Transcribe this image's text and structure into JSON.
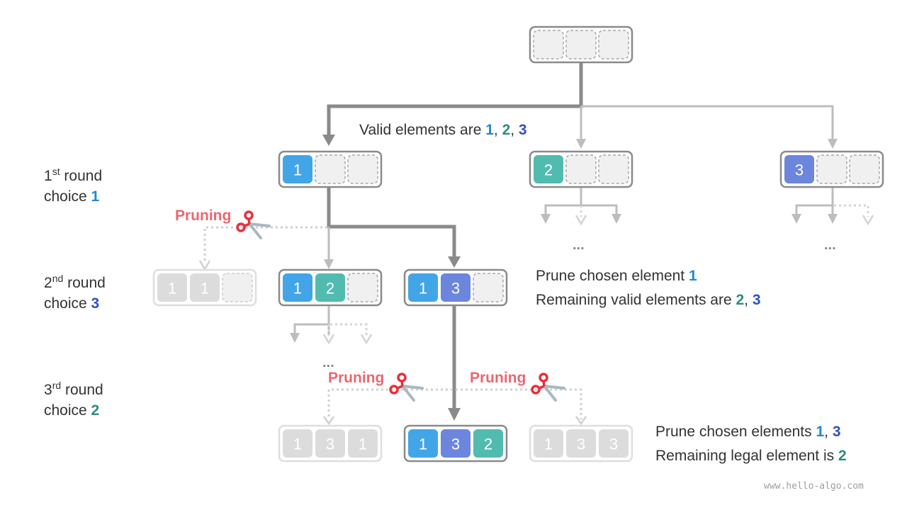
{
  "colors": {
    "one": "#42a5e8",
    "two": "#52bbb0",
    "three": "#6c86de",
    "one_text": "#1f88d3",
    "two_text": "#2e8b80",
    "three_text": "#2f4fcc",
    "empty_fill": "#f0f0f0",
    "empty_dash": "#a8a8a8",
    "faded_fill": "#dcdcdc",
    "faded_border": "#dedede",
    "active_border": "#8a8a8a",
    "main_edge": "#8a8a8a",
    "side_edge": "#bdbdbd",
    "pruned_edge": "#d4d4d4",
    "prune_label": "#e8686f"
  },
  "rounds": [
    {
      "sup_num": "1",
      "sup": "st",
      "word": " round",
      "choice_label": "choice ",
      "choice_value": "1",
      "choice_color": "one_text"
    },
    {
      "sup_num": "2",
      "sup": "nd",
      "word": " round",
      "choice_label": "choice ",
      "choice_value": "3",
      "choice_color": "three_text"
    },
    {
      "sup_num": "3",
      "sup": "rd",
      "word": " round",
      "choice_label": "choice ",
      "choice_value": "2",
      "choice_color": "two_text"
    }
  ],
  "notes": {
    "valid": {
      "prefix": "Valid elements are ",
      "v1": "1",
      "sep1": ", ",
      "v2": "2",
      "sep2": ", ",
      "v3": "3"
    },
    "round2_line1": {
      "prefix": "Prune chosen element ",
      "v1": "1"
    },
    "round2_line2": {
      "prefix": "Remaining valid elements are ",
      "v1": "2",
      "sep": ", ",
      "v2": "3"
    },
    "round3_line1": {
      "prefix": "Prune chosen elements ",
      "v1": "1",
      "sep": ", ",
      "v2": "3"
    },
    "round3_line2": {
      "prefix": "Remaining legal element is ",
      "v1": "2"
    }
  },
  "prune_label": "Pruning",
  "ellipsis": "...",
  "watermark": "www.hello-algo.com",
  "nodes": {
    "root": {
      "cells": [
        "",
        "",
        ""
      ],
      "state": "active"
    },
    "l1_a": {
      "cells": [
        "1",
        "",
        ""
      ],
      "state": "active"
    },
    "l1_b": {
      "cells": [
        "2",
        "",
        ""
      ],
      "state": "active"
    },
    "l1_c": {
      "cells": [
        "3",
        "",
        ""
      ],
      "state": "active"
    },
    "l2_a": {
      "cells": [
        "1",
        "1",
        ""
      ],
      "state": "pruned"
    },
    "l2_b": {
      "cells": [
        "1",
        "2",
        ""
      ],
      "state": "active"
    },
    "l2_c": {
      "cells": [
        "1",
        "3",
        ""
      ],
      "state": "active"
    },
    "l3_a": {
      "cells": [
        "1",
        "3",
        "1"
      ],
      "state": "pruned"
    },
    "l3_b": {
      "cells": [
        "1",
        "3",
        "2"
      ],
      "state": "active"
    },
    "l3_c": {
      "cells": [
        "1",
        "3",
        "3"
      ],
      "state": "pruned"
    }
  }
}
